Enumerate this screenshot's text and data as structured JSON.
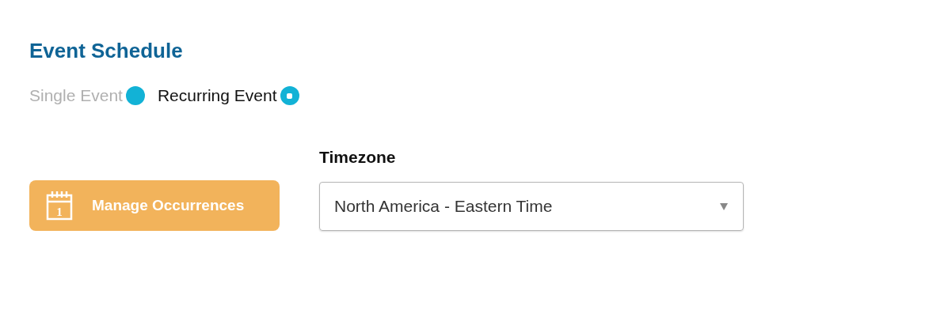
{
  "title": "Event Schedule",
  "event_types": [
    {
      "label": "Single Event",
      "selected": false
    },
    {
      "label": "Recurring Event",
      "selected": true
    }
  ],
  "manage_button": {
    "label": "Manage Occurrences",
    "calendar_day": "1"
  },
  "timezone": {
    "label": "Timezone",
    "value": "North America - Eastern Time"
  }
}
